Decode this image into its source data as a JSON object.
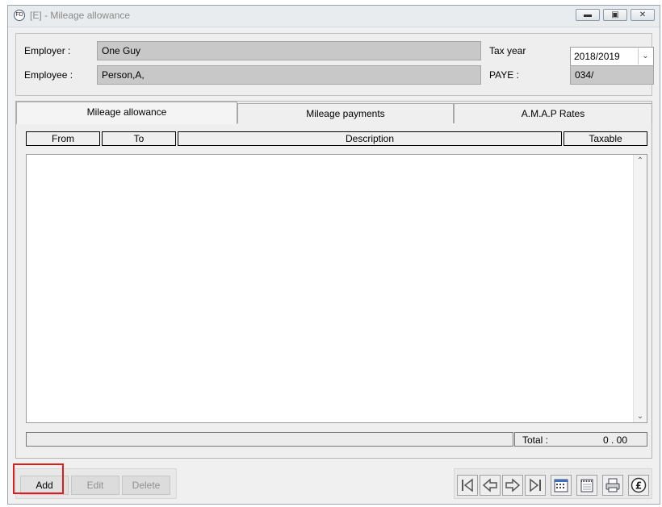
{
  "window": {
    "title": "[E] - Mileage allowance",
    "app_icon": "app-logo-icon",
    "controls": {
      "minimize": "minimize-icon",
      "restore": "restore-icon",
      "close": "close-icon"
    }
  },
  "header": {
    "employer_label": "Employer :",
    "employer_value": "One Guy",
    "employee_label": "Employee :",
    "employee_value": "Person,A,",
    "tax_year_label": "Tax year",
    "tax_year_value": "2018/2019",
    "paye_label": "PAYE :",
    "paye_value": "034/"
  },
  "tabs": [
    {
      "label": "Mileage allowance",
      "active": true
    },
    {
      "label": "Mileage payments",
      "active": false
    },
    {
      "label": "A.M.A.P Rates",
      "active": false
    }
  ],
  "table": {
    "columns": [
      "From",
      "To",
      "Description",
      "Taxable"
    ],
    "rows": []
  },
  "total": {
    "label": "Total :",
    "value": "0 . 00"
  },
  "actions": {
    "add": "Add",
    "edit": "Edit",
    "delete": "Delete"
  },
  "navigation": {
    "icons": [
      "first-record-icon",
      "previous-record-icon",
      "next-record-icon",
      "last-record-icon",
      "calendar-icon",
      "notepad-icon",
      "print-icon",
      "pound-icon"
    ]
  },
  "colors": {
    "highlight": "#e01b1b",
    "readonly_field": "#c8c8c8"
  }
}
